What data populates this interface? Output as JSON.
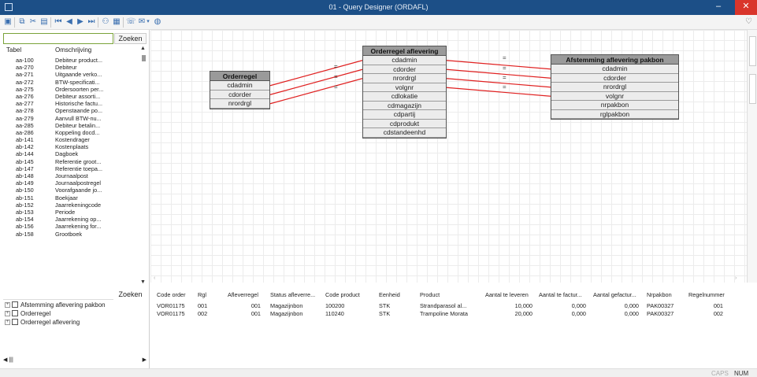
{
  "window": {
    "title": "01 - Query Designer (ORDAFL)",
    "minimize": "–",
    "maximize": "□",
    "close": "✕"
  },
  "left_panel": {
    "search_placeholder": "",
    "search_button": "Zoeken",
    "col_tabel": "Tabel",
    "col_omschrijving": "Omschrijving",
    "rows": [
      {
        "code": "aa-100",
        "desc": "Debiteur product..."
      },
      {
        "code": "aa-270",
        "desc": "Debiteur"
      },
      {
        "code": "aa-271",
        "desc": "Uitgaande verko..."
      },
      {
        "code": "aa-272",
        "desc": "BTW-specificati..."
      },
      {
        "code": "aa-275",
        "desc": "Ordersoorten per..."
      },
      {
        "code": "aa-276",
        "desc": "Debiteur assorti..."
      },
      {
        "code": "aa-277",
        "desc": "Historische factu..."
      },
      {
        "code": "aa-278",
        "desc": "Openstaande po..."
      },
      {
        "code": "aa-279",
        "desc": "Aanvull BTW-nu..."
      },
      {
        "code": "aa-285",
        "desc": "Debiteur betalin..."
      },
      {
        "code": "aa-286",
        "desc": "Koppeling docd..."
      },
      {
        "code": "ab-141",
        "desc": "Kostendrager"
      },
      {
        "code": "ab-142",
        "desc": "Kostenplaats"
      },
      {
        "code": "ab-144",
        "desc": "Dagboek"
      },
      {
        "code": "ab-145",
        "desc": "Referentie groot..."
      },
      {
        "code": "ab-147",
        "desc": "Referentie toepa..."
      },
      {
        "code": "ab-148",
        "desc": "Journaalpost"
      },
      {
        "code": "ab-149",
        "desc": "Journaalpostregel"
      },
      {
        "code": "ab-150",
        "desc": "Voorafgaande jo..."
      },
      {
        "code": "ab-151",
        "desc": "Boekjaar"
      },
      {
        "code": "ab-152",
        "desc": "Jaarrekeningcode"
      },
      {
        "code": "ab-153",
        "desc": "Periode"
      },
      {
        "code": "ab-154",
        "desc": "Jaarrekening op..."
      },
      {
        "code": "ab-156",
        "desc": "Jaarrekening for..."
      },
      {
        "code": "ab-158",
        "desc": "Grootboek"
      }
    ]
  },
  "entities": {
    "orderregel": {
      "title": "Orderregel",
      "fields": [
        "cdadmin",
        "cdorder",
        "nrordrgl"
      ]
    },
    "aflevering": {
      "title": "Orderregel aflevering",
      "fields": [
        "cdadmin",
        "cdorder",
        "nrordrgl",
        "volgnr",
        "cdlokatie",
        "cdmagazijn",
        "cdpartij",
        "cdprodukt",
        "cdstandeenhd"
      ]
    },
    "pakbon": {
      "title": "Afstemming aflevering pakbon",
      "fields": [
        "cdadmin",
        "cdorder",
        "nrordrgl",
        "volgnr",
        "nrpakbon",
        "rglpakbon"
      ]
    }
  },
  "relation_label": "=",
  "tree": {
    "search_button": "Zoeken",
    "items": [
      "Afstemming aflevering pakbon",
      "Orderregel",
      "Orderregel aflevering"
    ],
    "expander": "+"
  },
  "results": {
    "headers": [
      "Code order",
      "Rgl",
      "Afleverregel",
      "Status afleverre...",
      "Code product",
      "Eenheid",
      "Product",
      "Aantal te leveren",
      "Aantal te factur...",
      "Aantal gefactur...",
      "Nrpakbon",
      "Regelnummer"
    ],
    "rows": [
      [
        "VOR01175",
        "001",
        "001",
        "Magazijnbon",
        "100200",
        "STK",
        "Strandparasol al...",
        "10,000",
        "0,000",
        "0,000",
        "PAK00327",
        "001"
      ],
      [
        "VOR01175",
        "002",
        "001",
        "Magazijnbon",
        "110240",
        "STK",
        "Trampoline Morata",
        "20,000",
        "0,000",
        "0,000",
        "PAK00327",
        "002"
      ]
    ]
  },
  "status": {
    "caps": "CAPS",
    "num": "NUM"
  }
}
